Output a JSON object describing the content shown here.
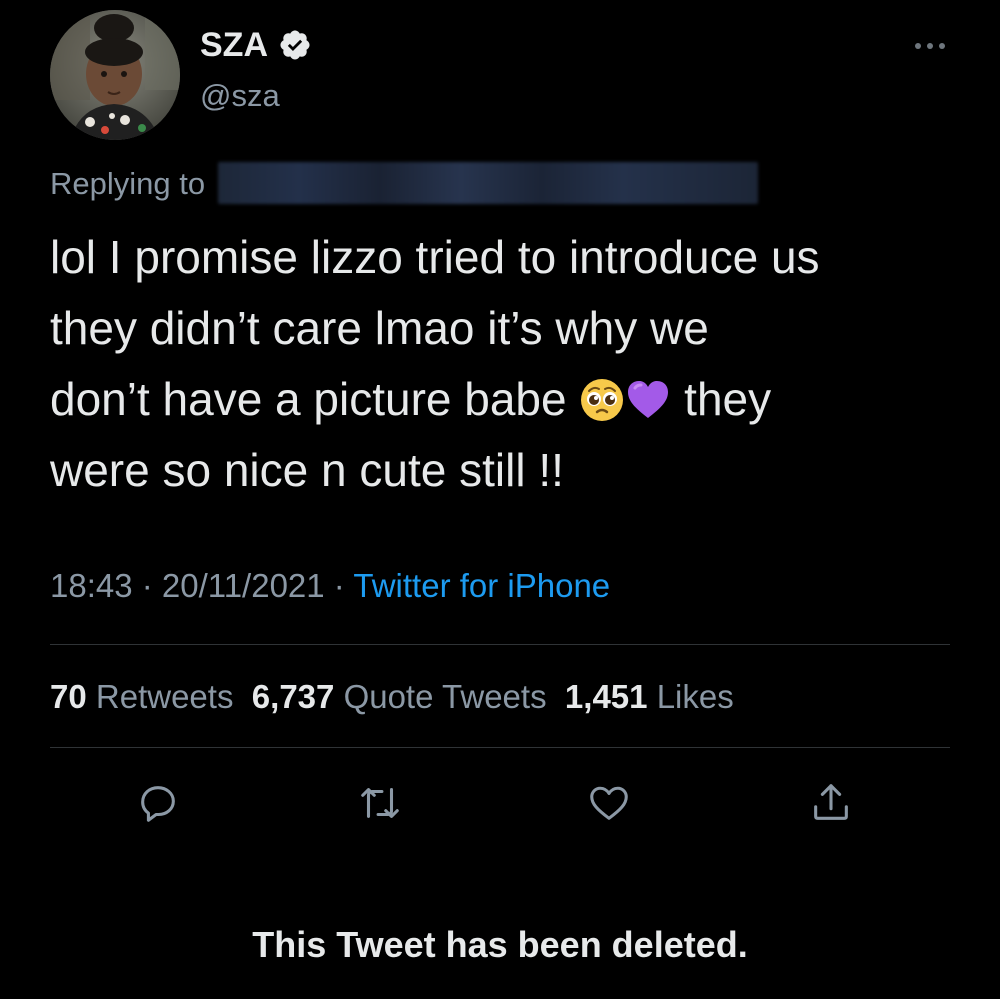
{
  "tweet": {
    "author": {
      "display_name": "SZA",
      "handle": "@sza",
      "verified": true,
      "avatar_icon": "profile-photo"
    },
    "reply": {
      "label": "Replying to ",
      "target_redacted": true
    },
    "text_lines": [
      "lol I promise lizzo tried to introduce us",
      "they didn’t care lmao it’s why we",
      "don’t have a picture babe",
      "they",
      "were so nice n cute still !!"
    ],
    "emoji": [
      "pleading-face-emoji",
      "purple-heart-emoji"
    ],
    "time": "18:43",
    "separator": " · ",
    "date": "20/11/2021",
    "source": "Twitter for iPhone",
    "stats": {
      "retweets_count": "70",
      "retweets_label": "Retweets",
      "quotes_count": "6,737",
      "quotes_label": "Quote Tweets",
      "likes_count": "1,451",
      "likes_label": "Likes"
    },
    "actions": [
      "reply-icon",
      "retweet-icon",
      "like-icon",
      "share-icon"
    ]
  },
  "status_message": "This Tweet has been deleted.",
  "colors": {
    "background": "#000000",
    "primary_text": "#e7e9ea",
    "secondary_text": "#8b98a5",
    "link": "#1d9bf0",
    "verified": "#e7e9ea",
    "divider": "#2f3336",
    "emoji_heart": "#a35ae8",
    "emoji_face": "#f7c94a"
  }
}
